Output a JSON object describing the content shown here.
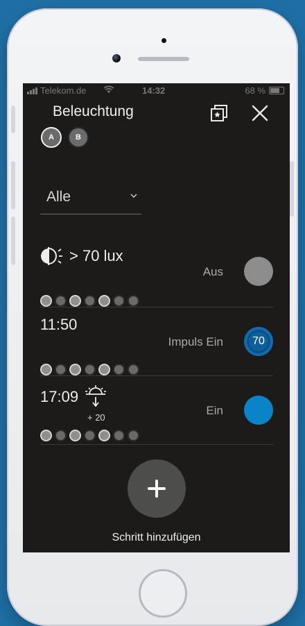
{
  "status_bar": {
    "carrier": "Telekom.de",
    "time": "14:32",
    "battery": "68 %"
  },
  "header": {
    "title": "Beleuchtung"
  },
  "zones": [
    {
      "label": "A",
      "selected": true
    },
    {
      "label": "B",
      "selected": false
    }
  ],
  "filter": {
    "selected": "Alle"
  },
  "steps": [
    {
      "trigger": "> 70 lux",
      "trigger_icon": "light-sensor-icon",
      "state_label": "Aus",
      "button_label": "",
      "button_style": "off",
      "days_active": [
        true,
        false,
        true,
        false,
        true,
        false,
        false
      ]
    },
    {
      "trigger": "11:50",
      "state_label": "Impuls Ein",
      "button_label": "70",
      "button_style": "impulse",
      "days_active": [
        true,
        false,
        true,
        false,
        true,
        false,
        false
      ]
    },
    {
      "trigger": "17:09",
      "trigger_icon": "sunset-icon",
      "offset": "+ 20",
      "state_label": "Ein",
      "button_label": "",
      "button_style": "on",
      "days_active": [
        true,
        false,
        true,
        false,
        true,
        false,
        false
      ]
    }
  ],
  "add_step": {
    "label": "Schritt hinzufügen"
  },
  "colors": {
    "screen_bg": "#1c1b19",
    "accent_blue": "#0a84c6",
    "off_gray": "#8c8c8c"
  }
}
